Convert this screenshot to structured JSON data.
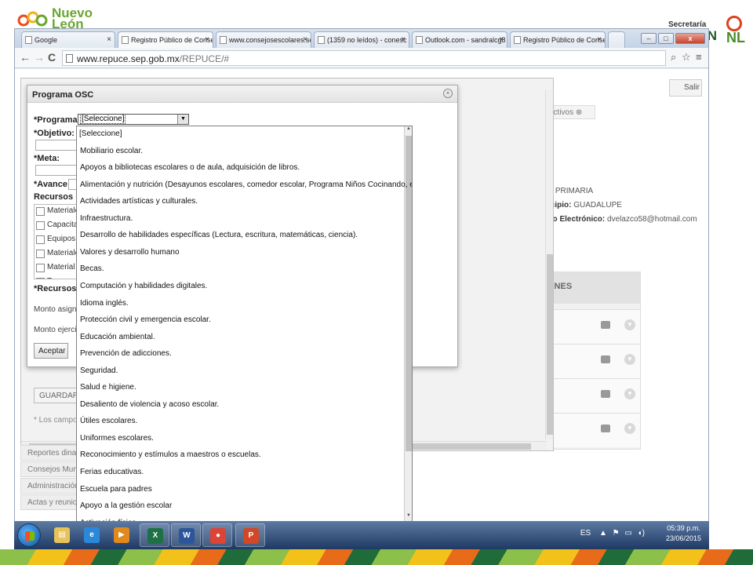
{
  "slide": {
    "logo_left_text": "Nuevo León",
    "logo_right_secretaria": "Secretaría de",
    "logo_right_on": "ÓN",
    "logo_right_nl": "NL"
  },
  "browser": {
    "tabs": [
      {
        "label": "Google",
        "active": false
      },
      {
        "label": "Registro Público de Conse",
        "active": true
      },
      {
        "label": "www.consejosescolares.se",
        "active": false
      },
      {
        "label": "(1359 no leídos) - conesc",
        "active": false
      },
      {
        "label": "Outlook.com - sandralcg8",
        "active": false
      },
      {
        "label": "Registro Público de Conse",
        "active": false
      }
    ],
    "window_buttons": {
      "minimize": "–",
      "maximize": "□",
      "close": "x"
    },
    "url_host": "www.repuce.sep.gob.mx",
    "url_path": "/REPUCE/#"
  },
  "app": {
    "salir_label": "Salir",
    "bg_tab_label": "uctivos",
    "info": {
      "nivel_label": "l:",
      "nivel_value": "PRIMARIA",
      "municipio_label": "icipio:",
      "municipio_value": "GUADALUPE",
      "correo_label": "eo Electrónico:",
      "correo_value": "dvelazco58@hotmail.com"
    },
    "grid_header": "ONES",
    "sidebar": [
      "Reportes dinam",
      "Consejos Munic",
      "Administración",
      "Actas y reunion"
    ],
    "guardar_label": "GUARDAR",
    "note_text": "* Los campos s"
  },
  "modal": {
    "title": "Programa OSC",
    "close_symbol": "×",
    "programa_label": "*Programa:",
    "programa_value": "[Seleccione]",
    "objetivo_label": "*Objetivo:",
    "meta_label": "*Meta:",
    "avance_label": "*Avance:",
    "recursos_label": "Recursos no",
    "recursos_items": [
      "Materiale",
      "Capacitac",
      "Equipos d",
      "Materiale",
      "Material d",
      "T"
    ],
    "recursos2_label": "*Recursos d",
    "monto_asignado": "Monto asigna",
    "monto_ejercido": "Monto ejercid",
    "aceptar_label": "Aceptar"
  },
  "dropdown_options": [
    "[Seleccione]",
    "Mobiliario escolar.",
    "Apoyos a bibliotecas escolares o de aula, adquisición de libros.",
    "Alimentación y nutrición (Desayunos escolares, comedor escolar, Programa Niños Cocinando, etc.)",
    "Actividades artísticas y culturales.",
    "Infraestructura.",
    "Desarrollo de habilidades específicas (Lectura, escritura, matemáticas, ciencia).",
    "Valores y desarrollo humano",
    "Becas.",
    "Computación y habilidades digitales.",
    "Idioma inglés.",
    "Protección civil y emergencia escolar.",
    "Educación ambiental.",
    "Prevención de adicciones.",
    "Seguridad.",
    "Salud e higiene.",
    "Desaliento de violencia y acoso escolar.",
    "Útiles escolares.",
    "Uniformes escolares.",
    "Reconocimiento y estímulos a maestros o escuelas.",
    "Ferias educativas.",
    "Escuela para padres",
    "Apoyo a la gestión escolar",
    "Activación física"
  ],
  "taskbar": {
    "language": "ES",
    "time": "05:39 p.m.",
    "date": "23/06/2015",
    "apps": [
      {
        "icon": "explorer-folder-icon",
        "glyph": "▤",
        "color": "#e8c35a"
      },
      {
        "icon": "internet-explorer-icon",
        "glyph": "e",
        "color": "#2b88d8"
      },
      {
        "icon": "media-player-icon",
        "glyph": "▶",
        "color": "#e08a1e"
      },
      {
        "icon": "excel-icon",
        "glyph": "X",
        "color": "#1e7145"
      },
      {
        "icon": "word-icon",
        "glyph": "W",
        "color": "#2b579a"
      },
      {
        "icon": "chrome-icon",
        "glyph": "●",
        "color": "#db4437"
      },
      {
        "icon": "powerpoint-icon",
        "glyph": "P",
        "color": "#d24726"
      }
    ]
  }
}
